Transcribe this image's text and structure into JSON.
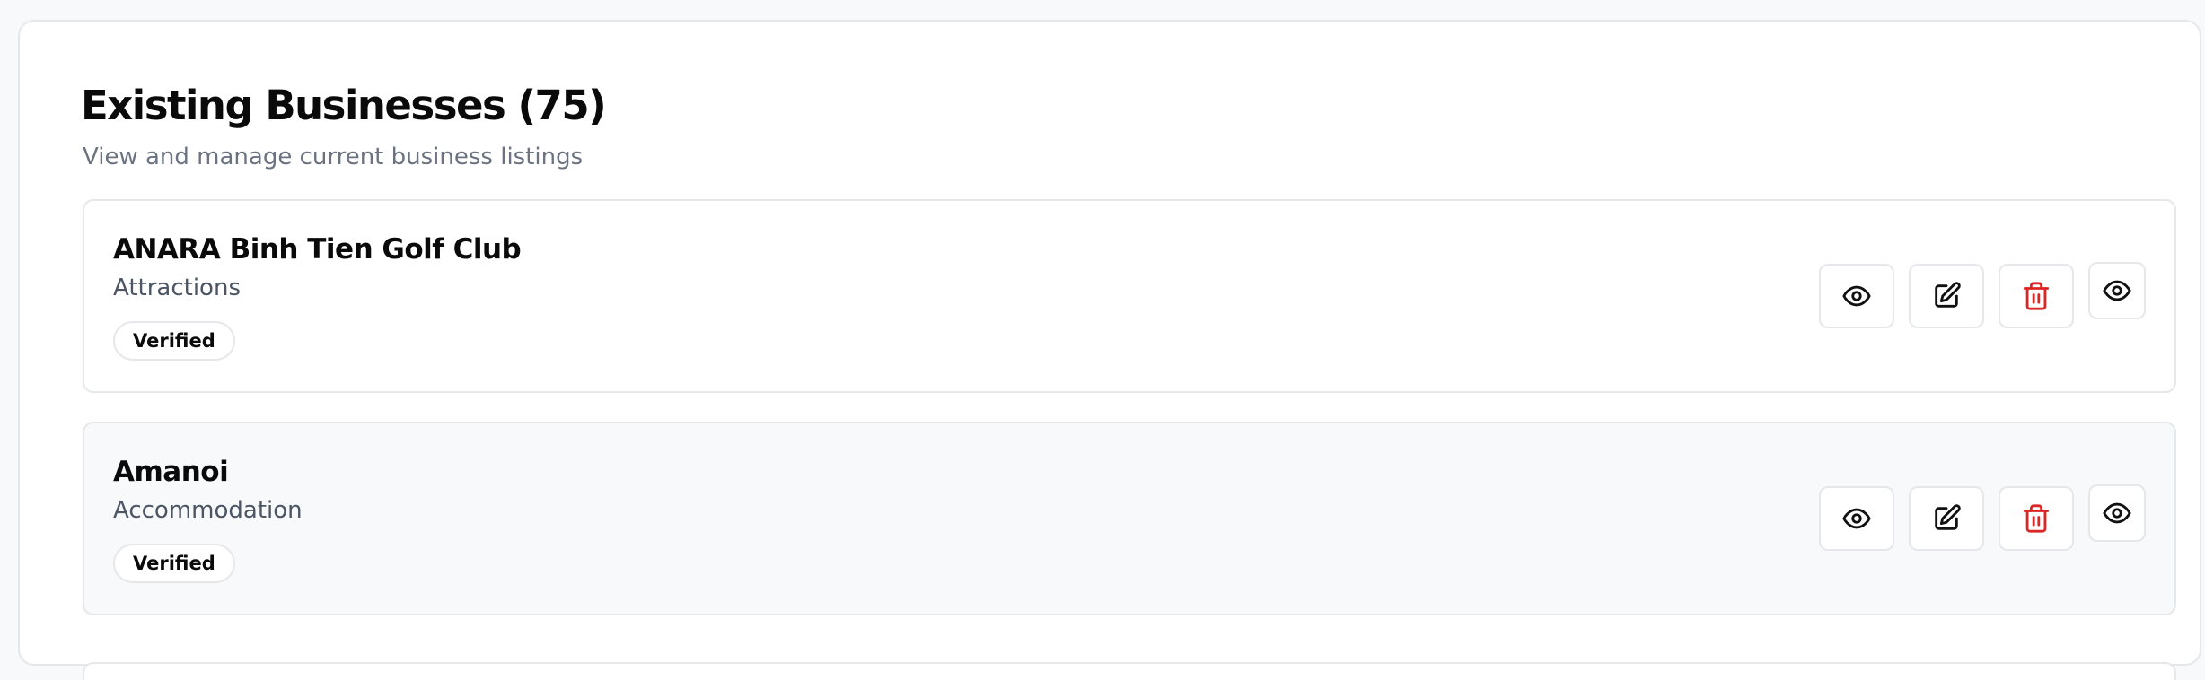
{
  "header": {
    "title": "Existing Businesses (75)",
    "subtitle": "View and manage current business listings"
  },
  "businesses": [
    {
      "name": "ANARA Binh Tien Golf Club",
      "category": "Attractions",
      "status": "Verified"
    },
    {
      "name": "Amanoi",
      "category": "Accommodation",
      "status": "Verified"
    }
  ],
  "icons": {
    "view": "eye-icon",
    "edit": "edit-icon",
    "delete": "trash-icon",
    "preview": "eye-icon"
  },
  "colors": {
    "delete": "#dc2626",
    "border": "#e5e7eb",
    "muted_text": "#6b7280"
  }
}
